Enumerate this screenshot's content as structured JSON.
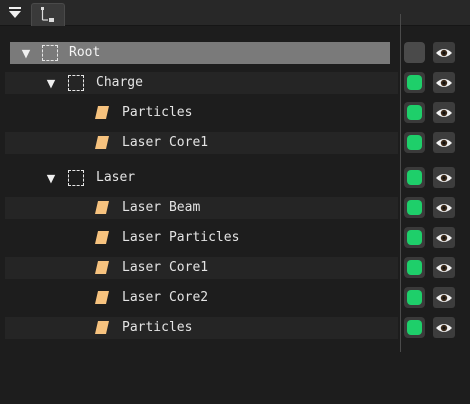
{
  "toolbar": {
    "menu_icon": "hamburger-dropdown-icon",
    "tab_icon": "outliner-tree-icon"
  },
  "outliner": {
    "rows": [
      {
        "label": "Root",
        "kind": "group",
        "expanded": true,
        "selected": true,
        "visible": false
      },
      {
        "label": "Charge",
        "kind": "group",
        "expanded": true,
        "selected": false,
        "visible": true
      },
      {
        "label": "Particles",
        "kind": "object",
        "selected": false,
        "visible": true
      },
      {
        "label": "Laser Core1",
        "kind": "object",
        "selected": false,
        "visible": true
      },
      {
        "label": "Laser",
        "kind": "group",
        "expanded": true,
        "selected": false,
        "visible": true
      },
      {
        "label": "Laser Beam",
        "kind": "object",
        "selected": false,
        "visible": true
      },
      {
        "label": "Laser Particles",
        "kind": "object",
        "selected": false,
        "visible": true
      },
      {
        "label": "Laser Core1",
        "kind": "object",
        "selected": false,
        "visible": true
      },
      {
        "label": "Laser Core2",
        "kind": "object",
        "selected": false,
        "visible": true
      },
      {
        "label": "Particles",
        "kind": "object",
        "selected": false,
        "visible": true
      }
    ]
  },
  "colors": {
    "visible_on": "#1ecf6a",
    "selected_row": "#7a7a7a",
    "object_icon": "#f6c27e"
  }
}
